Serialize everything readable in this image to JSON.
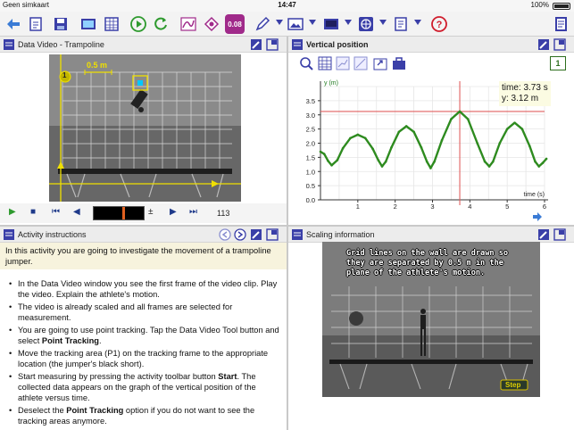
{
  "status": {
    "carrier": "Geen simkaart",
    "time": "14:47",
    "battery": "100%"
  },
  "colors": {
    "accent": "#3a3fa8",
    "curve": "#2e8b1f",
    "cursor": "#e06060",
    "tracker": "#f0e000",
    "intro_bg": "#f7f3dd"
  },
  "toolbar": {
    "icons": [
      "back-icon",
      "open-file-icon",
      "save-icon",
      "data-video-icon",
      "table-icon",
      "play-icon",
      "refresh-icon",
      "graph-icon",
      "diagram-icon",
      "value-display-icon",
      "edit-icon",
      "image-icon",
      "screen-icon",
      "globe-icon",
      "document-icon",
      "help-icon",
      "notebook-icon"
    ],
    "value_display_label": "0.08"
  },
  "video_panel": {
    "title": "Data Video - Trampoline",
    "scale_label": "0.5 m",
    "tracker_label": "1",
    "frame": "113",
    "plusminus": "±"
  },
  "graph_panel": {
    "title": "Vertical position",
    "page": "1",
    "readout": {
      "time": "time: 3.73 s",
      "y": "y: 3.12 m"
    }
  },
  "chart_data": {
    "type": "line",
    "title": "",
    "xlabel": "time (s)",
    "ylabel": "y (m)",
    "xlim": [
      0,
      6
    ],
    "ylim": [
      0,
      4
    ],
    "x_ticks": [
      1,
      2,
      3,
      4,
      5,
      6
    ],
    "y_ticks": [
      0.0,
      0.5,
      1.0,
      1.5,
      2.0,
      2.5,
      3.0,
      3.5
    ],
    "grid": true,
    "cursor": {
      "x": 3.73,
      "y": 3.12
    },
    "series": [
      {
        "values": [
          [
            0.0,
            1.7
          ],
          [
            0.1,
            1.62
          ],
          [
            0.2,
            1.38
          ],
          [
            0.3,
            1.22
          ],
          [
            0.45,
            1.4
          ],
          [
            0.6,
            1.82
          ],
          [
            0.8,
            2.18
          ],
          [
            1.0,
            2.3
          ],
          [
            1.2,
            2.18
          ],
          [
            1.4,
            1.8
          ],
          [
            1.55,
            1.4
          ],
          [
            1.65,
            1.18
          ],
          [
            1.75,
            1.35
          ],
          [
            1.9,
            1.85
          ],
          [
            2.1,
            2.4
          ],
          [
            2.3,
            2.6
          ],
          [
            2.5,
            2.4
          ],
          [
            2.7,
            1.85
          ],
          [
            2.85,
            1.35
          ],
          [
            2.95,
            1.12
          ],
          [
            3.05,
            1.35
          ],
          [
            3.25,
            2.1
          ],
          [
            3.5,
            2.85
          ],
          [
            3.73,
            3.12
          ],
          [
            3.95,
            2.85
          ],
          [
            4.2,
            2.0
          ],
          [
            4.4,
            1.35
          ],
          [
            4.52,
            1.18
          ],
          [
            4.62,
            1.35
          ],
          [
            4.8,
            2.0
          ],
          [
            5.0,
            2.5
          ],
          [
            5.2,
            2.72
          ],
          [
            5.4,
            2.5
          ],
          [
            5.6,
            1.9
          ],
          [
            5.75,
            1.35
          ],
          [
            5.85,
            1.18
          ],
          [
            5.95,
            1.3
          ],
          [
            6.05,
            1.45
          ]
        ]
      }
    ]
  },
  "instructions_panel": {
    "title": "Activity instructions",
    "intro": "In this activity you are going to investigate the movement of a trampoline jumper.",
    "items": [
      {
        "pre": "In the Data Video window you see the first frame of the video clip. Play the video. Explain the athlete's motion.",
        "bold": "",
        "post": ""
      },
      {
        "pre": "The video is already scaled and all frames are selected for measurement.",
        "bold": "",
        "post": ""
      },
      {
        "pre": "You are going to use point tracking. Tap the Data Video Tool button and select ",
        "bold": "Point Tracking",
        "post": "."
      },
      {
        "pre": "Move the tracking area (P1) on the tracking frame to the appropriate location (the jumper's black short).",
        "bold": "",
        "post": ""
      },
      {
        "pre": "Start measuring by pressing the activity toolbar button ",
        "bold": "Start",
        "post": ". The collected data appears on the graph of the vertical position of the athlete versus time."
      },
      {
        "pre": "Deselect the ",
        "bold": "Point Tracking",
        "post": " option if you do not want to see the tracking areas anymore."
      }
    ]
  },
  "scaling_panel": {
    "title": "Scaling information",
    "caption": "Grid lines on the wall are drawn so they are separated by 0.5 m in the plane of the athlete's motion.",
    "step_label": "Step"
  }
}
